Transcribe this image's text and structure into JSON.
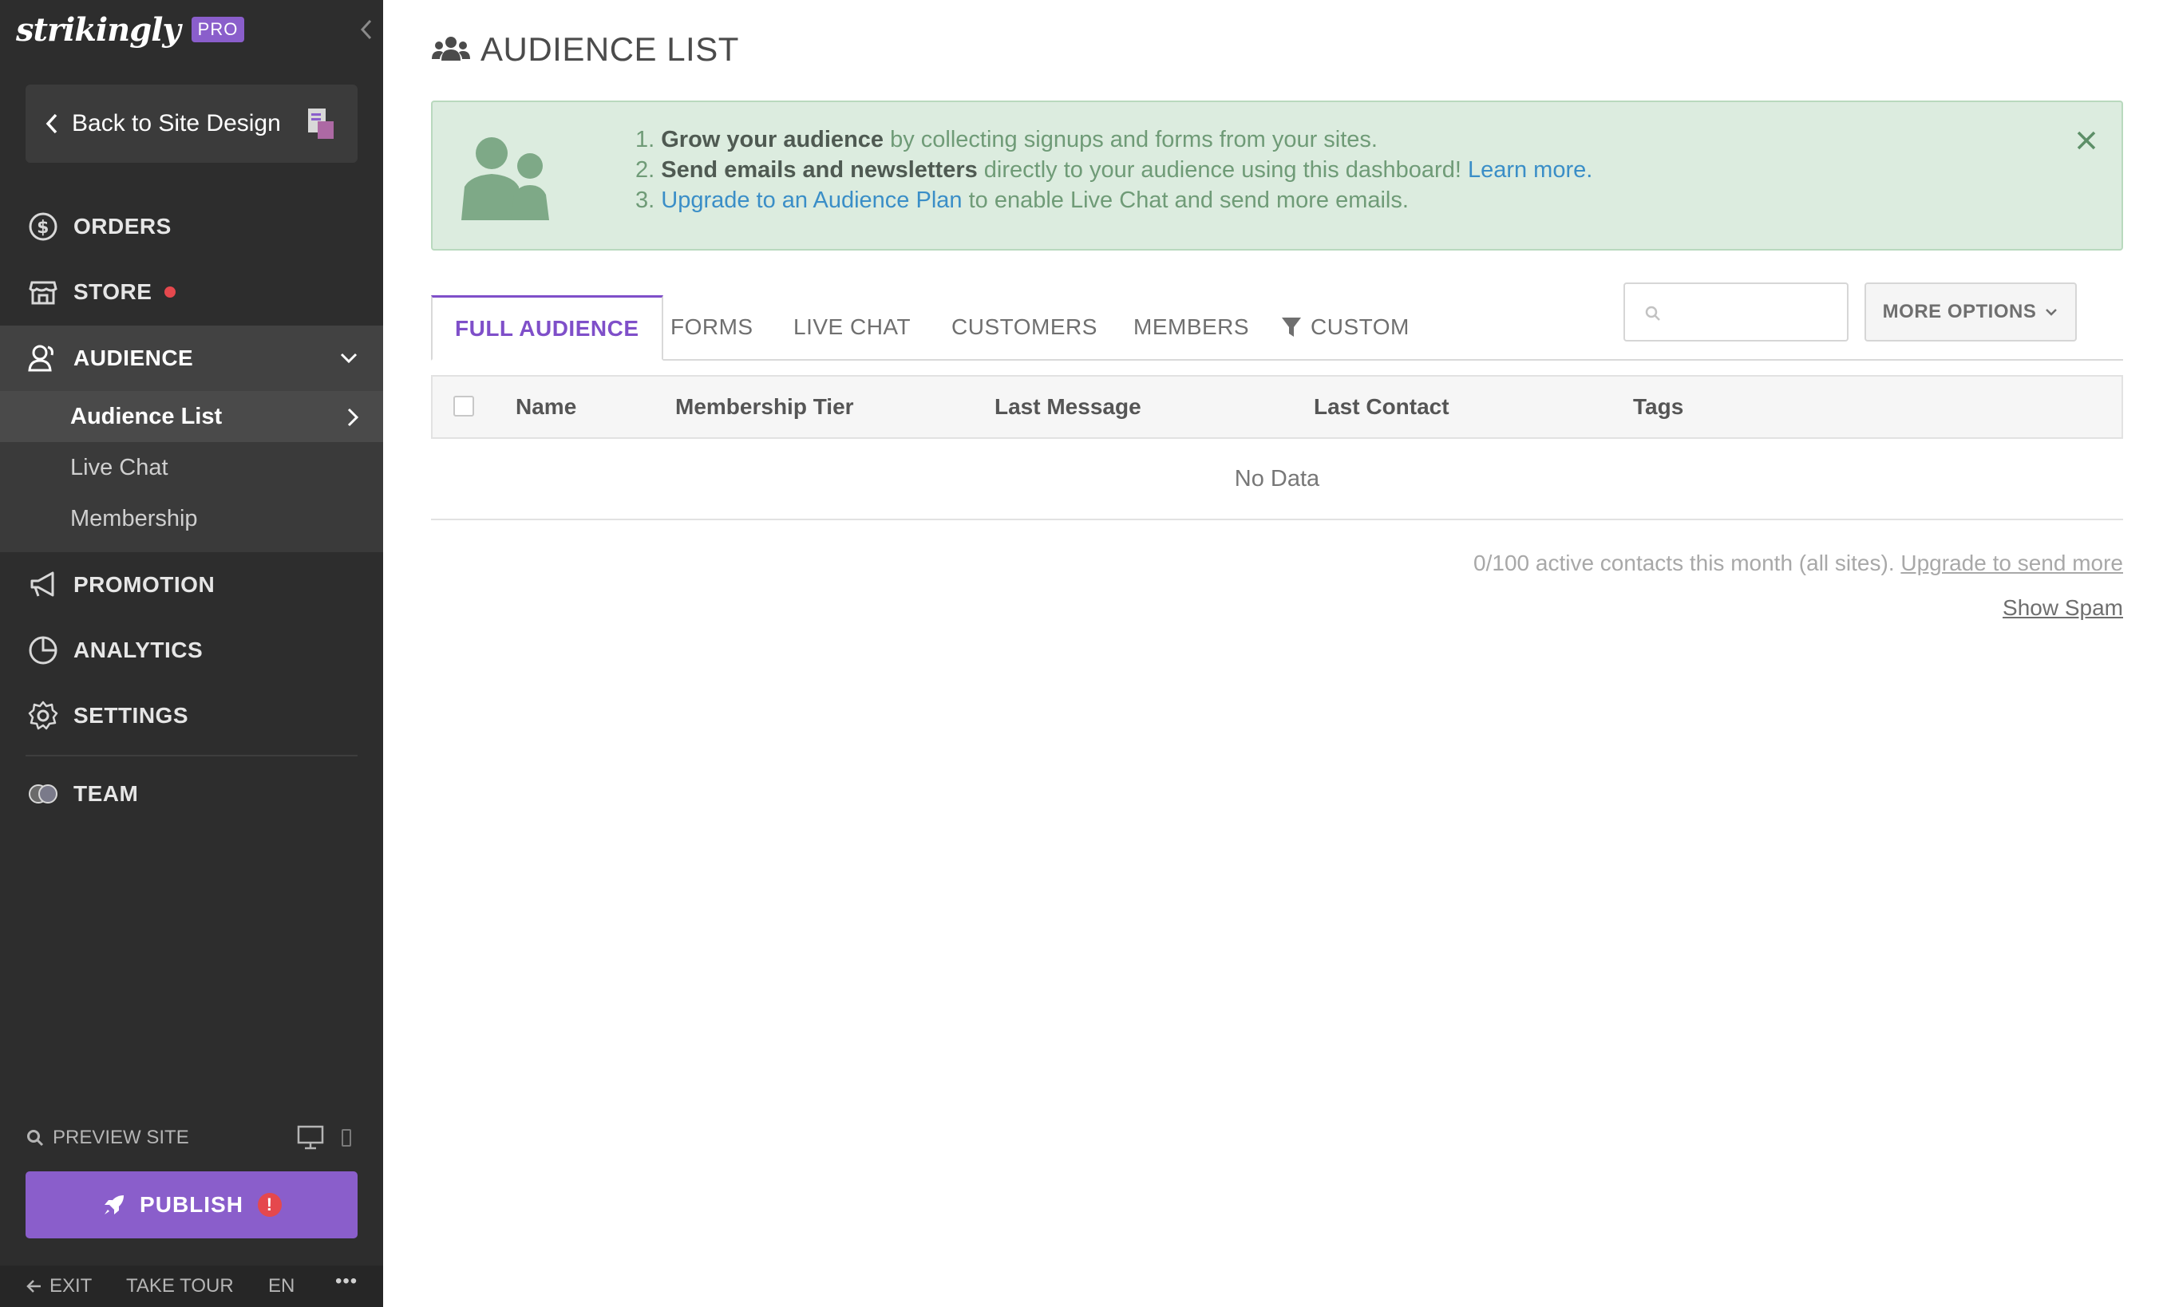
{
  "brand": {
    "logo_text": "strikingly",
    "badge": "PRO"
  },
  "sidebar": {
    "back_label": "Back to Site Design",
    "nav": [
      {
        "label": "ORDERS",
        "icon": "dollar-circle-icon"
      },
      {
        "label": "STORE",
        "icon": "store-icon",
        "notification_dot": true
      },
      {
        "label": "AUDIENCE",
        "icon": "audience-icon",
        "expanded": true
      },
      {
        "label": "PROMOTION",
        "icon": "megaphone-icon"
      },
      {
        "label": "ANALYTICS",
        "icon": "pie-chart-icon"
      },
      {
        "label": "SETTINGS",
        "icon": "gear-icon"
      },
      {
        "label": "TEAM",
        "icon": "team-icon"
      }
    ],
    "audience_sub": [
      {
        "label": "Audience List",
        "current": true
      },
      {
        "label": "Live Chat"
      },
      {
        "label": "Membership"
      }
    ],
    "preview_label": "PREVIEW SITE",
    "publish_label": "PUBLISH",
    "publish_warning": "!",
    "footer": {
      "exit": "EXIT",
      "tour": "TAKE TOUR",
      "lang": "EN",
      "more": "•••"
    }
  },
  "main": {
    "title": "AUDIENCE LIST",
    "banner": {
      "line1": {
        "num": "1.",
        "bold": "Grow your audience",
        "rest": " by collecting signups and forms from your sites."
      },
      "line2": {
        "num": "2.",
        "bold": "Send emails and newsletters",
        "rest": " directly to your audience using this dashboard! ",
        "link": "Learn more."
      },
      "line3": {
        "num": "3.",
        "link": "Upgrade to an Audience Plan",
        "rest": " to enable Live Chat and send more emails."
      }
    },
    "tabs": [
      "FULL AUDIENCE",
      "FORMS",
      "LIVE CHAT",
      "CUSTOMERS",
      "MEMBERS",
      "CUSTOM"
    ],
    "active_tab": "FULL AUDIENCE",
    "search": {
      "placeholder": "",
      "value": ""
    },
    "more_options_label": "MORE OPTIONS",
    "table": {
      "columns": [
        "Name",
        "Membership Tier",
        "Last Message",
        "Last Contact",
        "Tags"
      ],
      "empty_text": "No Data"
    },
    "usage_text": "0/100 active contacts this month (all sites).",
    "usage_link": "Upgrade to send more",
    "show_spam": "Show Spam"
  },
  "colors": {
    "accent": "#7f4fc9",
    "sidebar_bg": "#2d2d2d",
    "banner_bg": "#dcecdf",
    "alert": "#e5484d"
  }
}
